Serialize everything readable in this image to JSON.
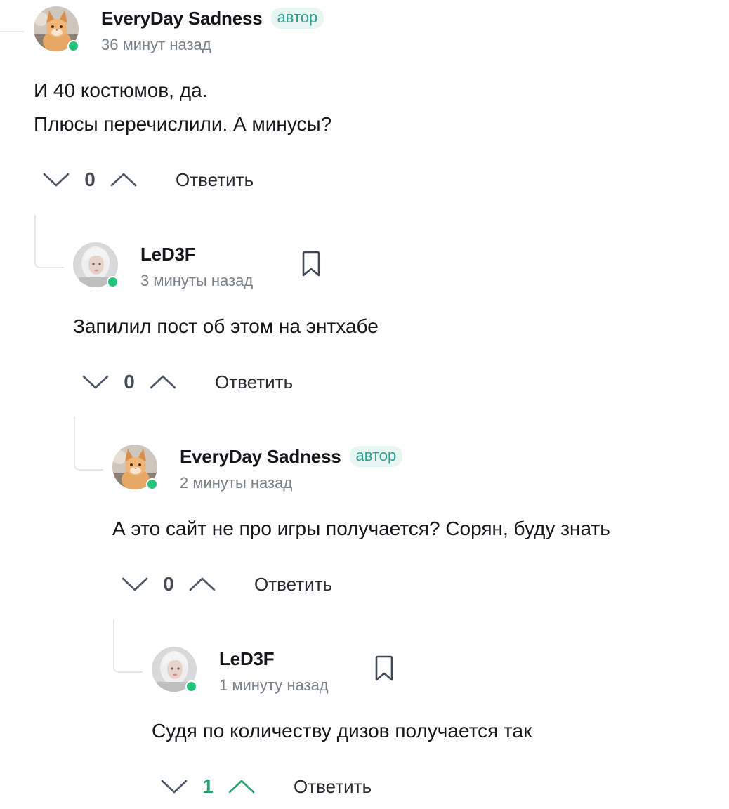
{
  "colors": {
    "accent_green": "#27c27a",
    "badge_text": "#2f9d8f",
    "badge_bg": "#e8f6f3",
    "positive_vote": "#27a36d",
    "muted_text": "#7b7f8a"
  },
  "comments": [
    {
      "author": "EveryDay Sadness",
      "badge": "автор",
      "time": "36 минут назад",
      "text": [
        "И 40 костюмов, да.",
        "Плюсы перечислили. А минусы?"
      ],
      "votes": "0",
      "reply": "Ответить",
      "avatar_icon": "cat-avatar",
      "online": true
    },
    {
      "author": "LeD3F",
      "time": "3 минуты назад",
      "text": [
        "Запилил пост об этом на энтхабе"
      ],
      "votes": "0",
      "reply": "Ответить",
      "avatar_icon": "person-avatar",
      "bookmark_icon": "bookmark-icon",
      "online": true
    },
    {
      "author": "EveryDay Sadness",
      "badge": "автор",
      "time": "2 минуты назад",
      "text": [
        "А это сайт не про игры получается? Сорян, буду знать"
      ],
      "votes": "0",
      "reply": "Ответить",
      "avatar_icon": "cat-avatar",
      "online": true
    },
    {
      "author": "LeD3F",
      "time": "1 минуту назад",
      "text": [
        "Судя по количеству дизов получается так"
      ],
      "votes": "1",
      "reply": "Ответить",
      "avatar_icon": "person-avatar",
      "bookmark_icon": "bookmark-icon",
      "online": true
    }
  ]
}
